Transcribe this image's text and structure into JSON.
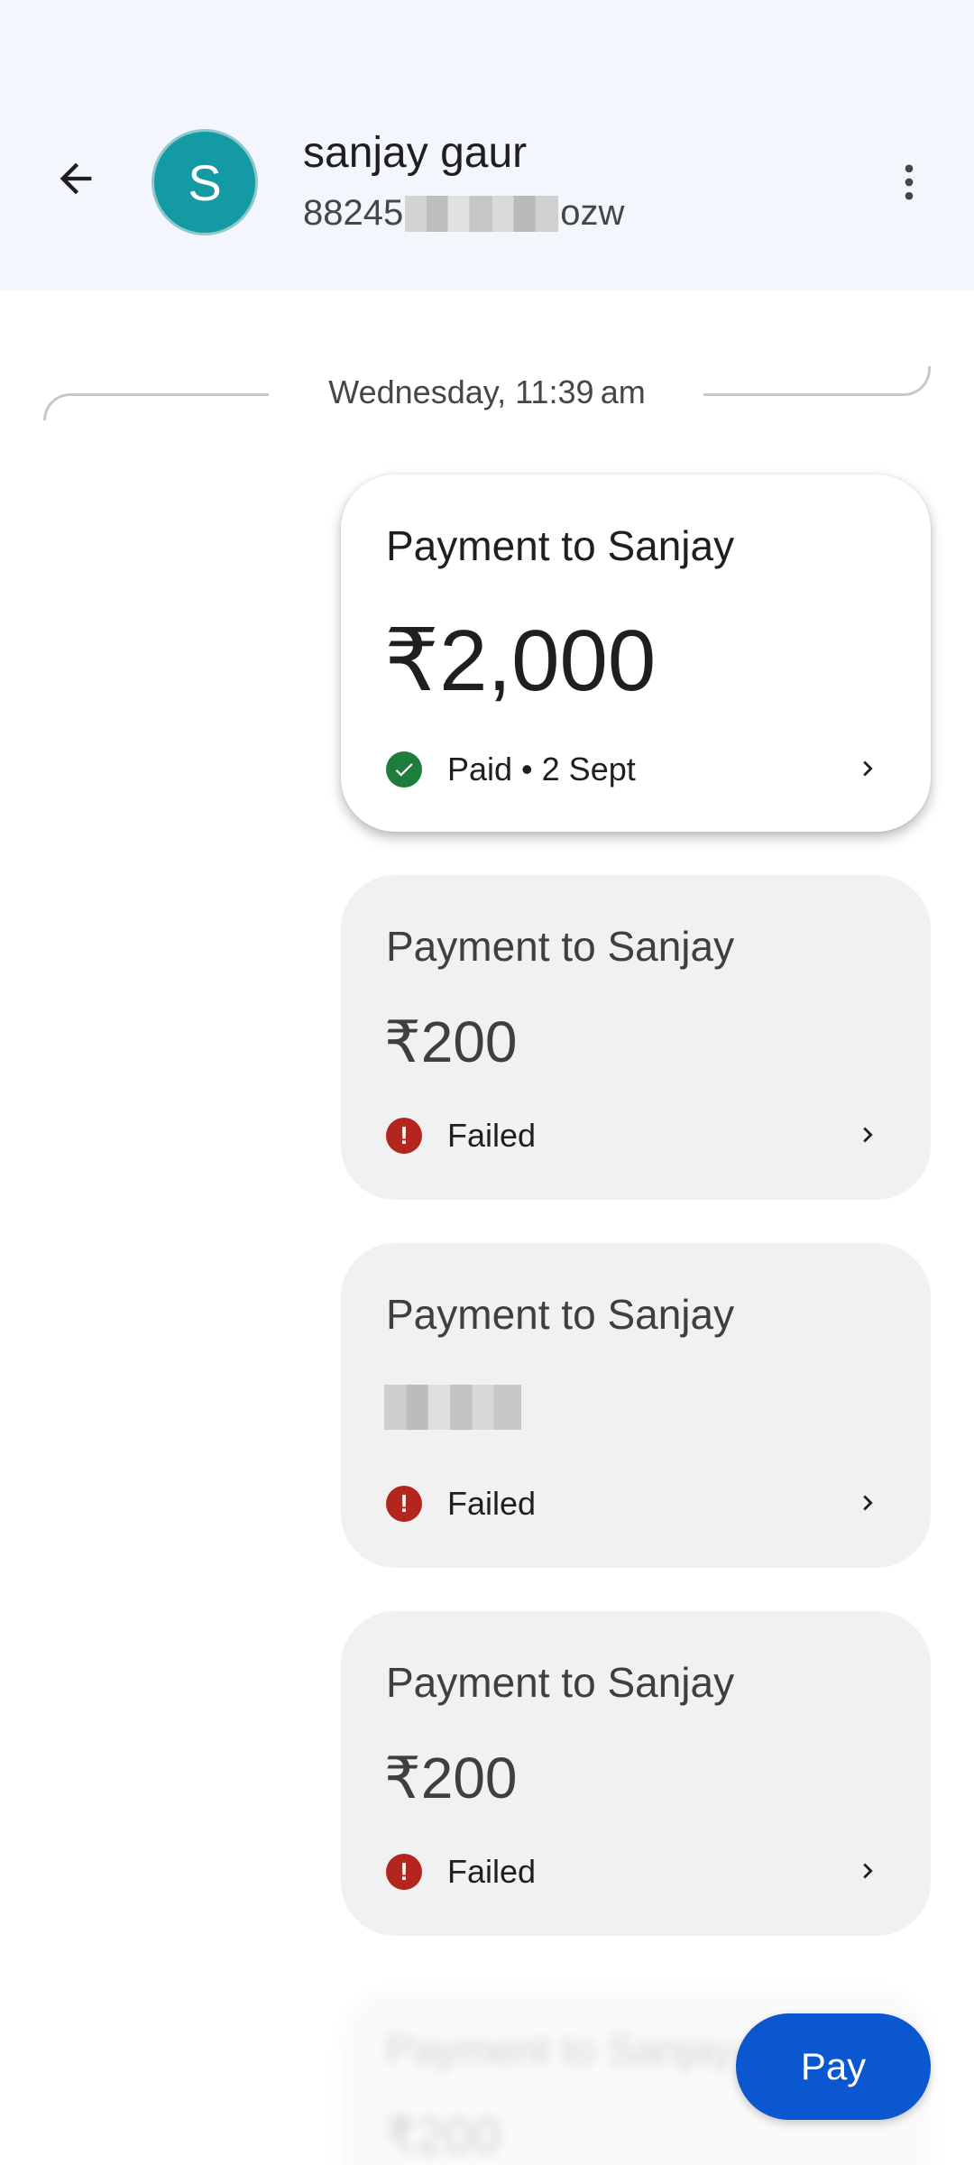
{
  "header": {
    "avatar_initial": "S",
    "contact_name": "sanjay gaur",
    "contact_id_prefix": "88245",
    "contact_id_suffix": "ozw",
    "avatar_color": "#139aa3",
    "background_color": "#f3f6fd"
  },
  "thread": {
    "date_divider": "Wednesday, 11:39 am",
    "payments": [
      {
        "title": "Payment to Sanjay",
        "amount": "₹2,000",
        "status": "Paid • 2 Sept",
        "state": "paid"
      },
      {
        "title": "Payment to Sanjay",
        "amount": "₹200",
        "status": "Failed",
        "state": "failed"
      },
      {
        "title": "Payment to Sanjay",
        "amount": "",
        "status": "Failed",
        "state": "failed"
      },
      {
        "title": "Payment to Sanjay",
        "amount": "₹200",
        "status": "Failed",
        "state": "failed"
      }
    ],
    "partial_card": {
      "title": "Payment to Sanjay",
      "amount": "₹200"
    }
  },
  "actions": {
    "pay_label": "Pay"
  },
  "colors": {
    "paid_green": "#1e7d3c",
    "failed_red": "#b3261e",
    "pay_blue": "#0b57d0"
  },
  "icons": {
    "back": "arrow-back-icon",
    "menu": "more-vert-icon",
    "paid": "check-circle-icon",
    "failed": "error-circle-icon",
    "chevron": "chevron-right-icon"
  }
}
